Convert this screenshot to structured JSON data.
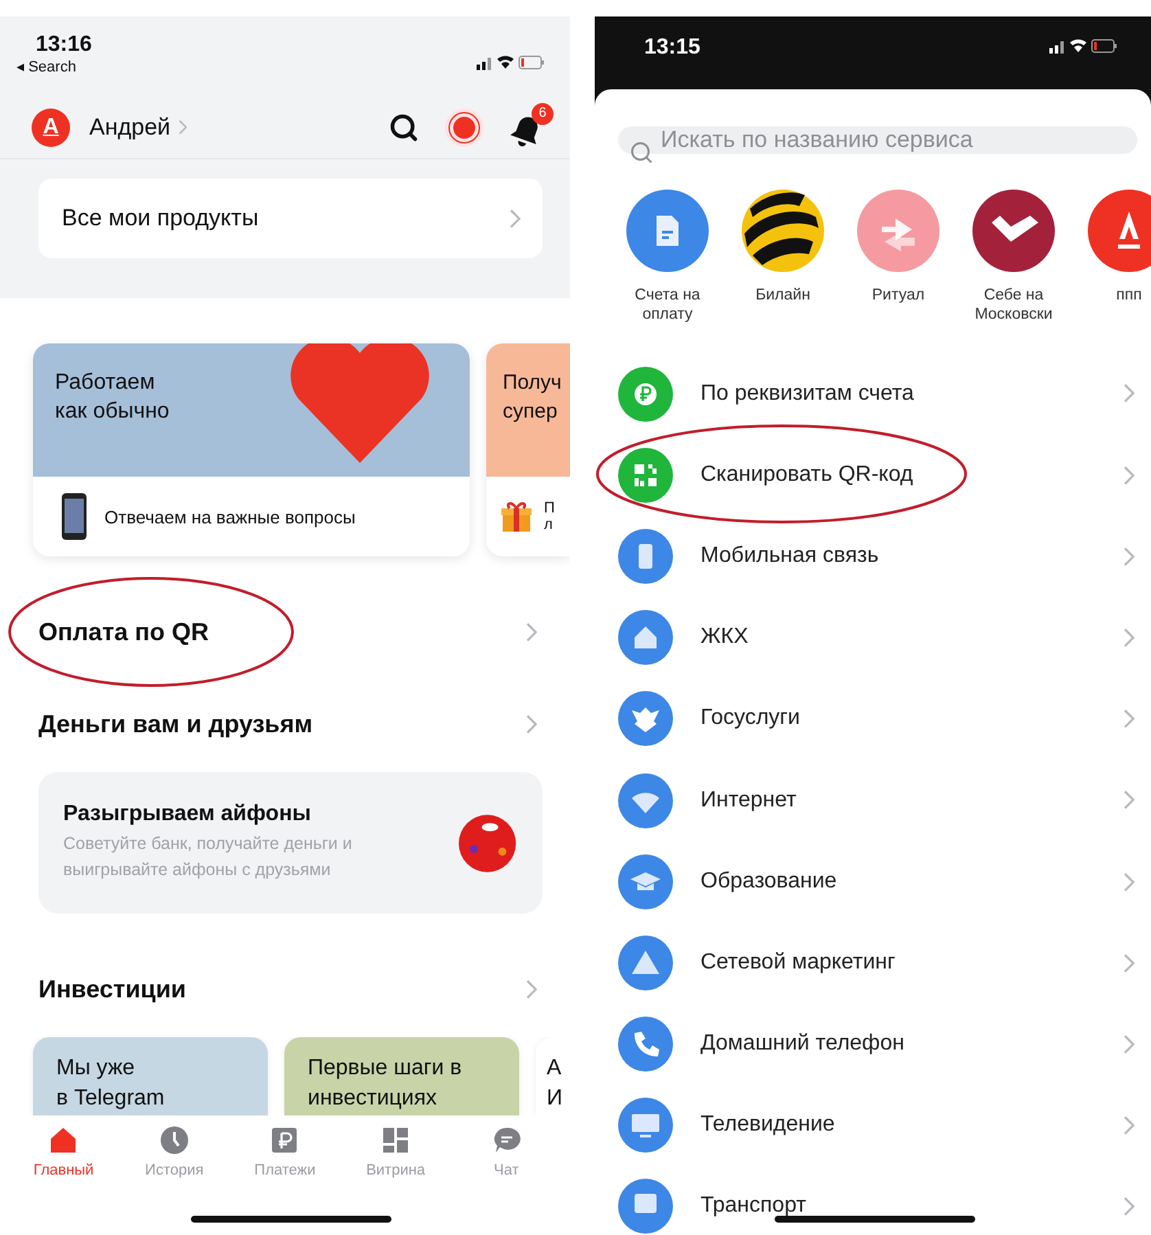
{
  "left_screen": {
    "status_bar": {
      "time": "13:16",
      "back_link": "◂ Search"
    },
    "header": {
      "logo_letter": "А",
      "user_name": "Андрей",
      "notification_count": "6"
    },
    "products_button": "Все мои продукты",
    "stories": [
      {
        "title": [
          "Работаем",
          "как обычно"
        ],
        "color": "#a5bfd9",
        "footer": [
          "Отвечаем на важные вопросы"
        ]
      },
      {
        "title": [
          "Получ",
          "супер"
        ],
        "color": "#f7b898",
        "footer": [
          "П",
          "л"
        ]
      }
    ],
    "sections": [
      {
        "title": "Оплата по QR",
        "highlighted": true
      },
      {
        "title": "Деньги вам и друзьям",
        "highlighted": false
      }
    ],
    "promo": {
      "title": "Разыгрываем айфоны",
      "text": "Советуйте банк, получайте деньги и выигрывайте айфоны с друзьями"
    },
    "investments": {
      "title": "Инвестиции",
      "cards": [
        {
          "title": [
            "Мы уже",
            "в Telegram"
          ],
          "color": "#c5d7e2"
        },
        {
          "title": [
            "Первые шаги в",
            "инвестициях"
          ],
          "color": "#c8d3a8"
        },
        {
          "title": [
            "А",
            "И"
          ],
          "color": "#ffffff"
        }
      ]
    },
    "tab_bar": [
      {
        "label": "Главный",
        "selected": true
      },
      {
        "label": "История",
        "selected": false
      },
      {
        "label": "Платежи",
        "selected": false
      },
      {
        "label": "Витрина",
        "selected": false
      },
      {
        "label": "Чат",
        "selected": false
      }
    ]
  },
  "right_screen": {
    "status_bar": {
      "time": "13:15"
    },
    "search": {
      "placeholder": "Искать по названию сервиса"
    },
    "favorites": [
      {
        "label": "Счета на оплату",
        "color": "#3d87e6"
      },
      {
        "label": "Билайн",
        "color": "#f4c20d"
      },
      {
        "label": "Ритуал",
        "color": "#f59aa0"
      },
      {
        "label": "Себе на Московски",
        "color": "#a3213a"
      },
      {
        "label": "ппп",
        "color": "#ef3124"
      }
    ],
    "services": [
      {
        "label": "По реквизитам счета",
        "color": "#1fb63b",
        "highlighted": false
      },
      {
        "label": "Сканировать QR-код",
        "color": "#1fb63b",
        "highlighted": true
      },
      {
        "label": "Мобильная связь",
        "color": "#3d87e6",
        "highlighted": false
      },
      {
        "label": "ЖКХ",
        "color": "#3d87e6",
        "highlighted": false
      },
      {
        "label": "Госуслуги",
        "color": "#3d87e6",
        "highlighted": false
      },
      {
        "label": "Интернет",
        "color": "#3d87e6",
        "highlighted": false
      },
      {
        "label": "Образование",
        "color": "#3d87e6",
        "highlighted": false
      },
      {
        "label": "Сетевой маркетинг",
        "color": "#3d87e6",
        "highlighted": false
      },
      {
        "label": "Домашний телефон",
        "color": "#3d87e6",
        "highlighted": false
      },
      {
        "label": "Телевидение",
        "color": "#3d87e6",
        "highlighted": false
      },
      {
        "label": "Транспорт",
        "color": "#3d87e6",
        "highlighted": false
      }
    ]
  }
}
